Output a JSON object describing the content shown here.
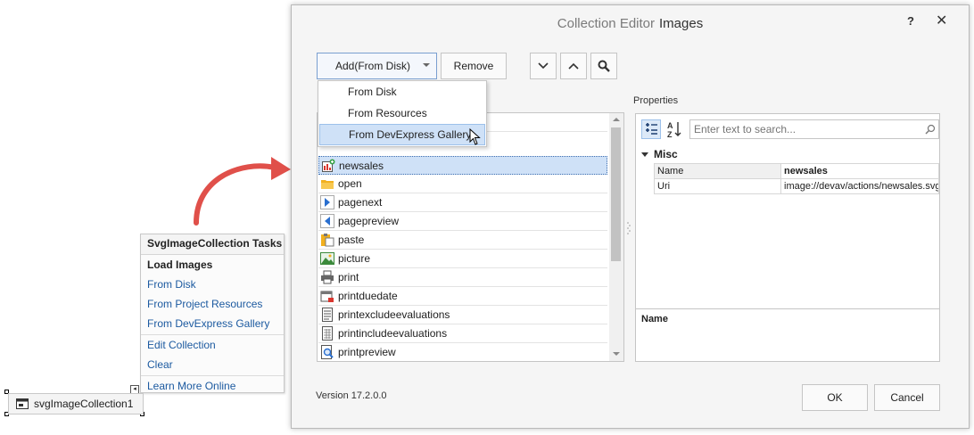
{
  "dialog": {
    "title_prefix": "Collection Editor",
    "title_main": "Images",
    "help_label": "?",
    "close_label": "✕",
    "toolbar": {
      "add_label": "Add(From Disk)",
      "remove_label": "Remove",
      "move_down_icon": "chevron-down-icon",
      "move_up_icon": "chevron-up-icon",
      "search_icon": "magnifier-icon"
    },
    "add_menu": {
      "options": [
        "From Disk",
        "From Resources",
        "From DevExpress Gallery"
      ],
      "highlighted": "From DevExpress Gallery"
    },
    "list": {
      "items": [
        {
          "name": "",
          "icon": "partial-icon"
        },
        {
          "name": "newsales",
          "icon": "newsales-icon",
          "selected": true
        },
        {
          "name": "open",
          "icon": "folder-icon"
        },
        {
          "name": "pagenext",
          "icon": "page-next-icon"
        },
        {
          "name": "pagepreview",
          "icon": "page-previous-icon"
        },
        {
          "name": "paste",
          "icon": "paste-icon"
        },
        {
          "name": "picture",
          "icon": "picture-icon"
        },
        {
          "name": "print",
          "icon": "printer-icon"
        },
        {
          "name": "printduedate",
          "icon": "print-due-date-icon"
        },
        {
          "name": "printexcludeevaluations",
          "icon": "document-lines-icon"
        },
        {
          "name": "printincludeevaluations",
          "icon": "document-grid-icon"
        },
        {
          "name": "printpreview",
          "icon": "print-preview-icon"
        }
      ]
    },
    "properties": {
      "label": "Properties",
      "search_placeholder": "Enter text to search...",
      "category": "Misc",
      "rows": [
        {
          "key": "Name",
          "value": "newsales"
        },
        {
          "key": "Uri",
          "value": "image://devav/actions/newsales.svg"
        }
      ],
      "description_title": "Name"
    },
    "version": "Version 17.2.0.0",
    "ok_label": "OK",
    "cancel_label": "Cancel"
  },
  "tasks_panel": {
    "title": "SvgImageCollection Tasks",
    "section": "Load Images",
    "load_links": [
      "From Disk",
      "From Project Resources",
      "From DevExpress Gallery"
    ],
    "edit_links": [
      "Edit Collection",
      "Clear"
    ],
    "learn_link": "Learn More Online"
  },
  "component": {
    "name": "svgImageCollection1"
  },
  "colors": {
    "selection": "#cfe1f7",
    "link": "#1c5aa0",
    "callout_arrow": "#e0504a"
  }
}
